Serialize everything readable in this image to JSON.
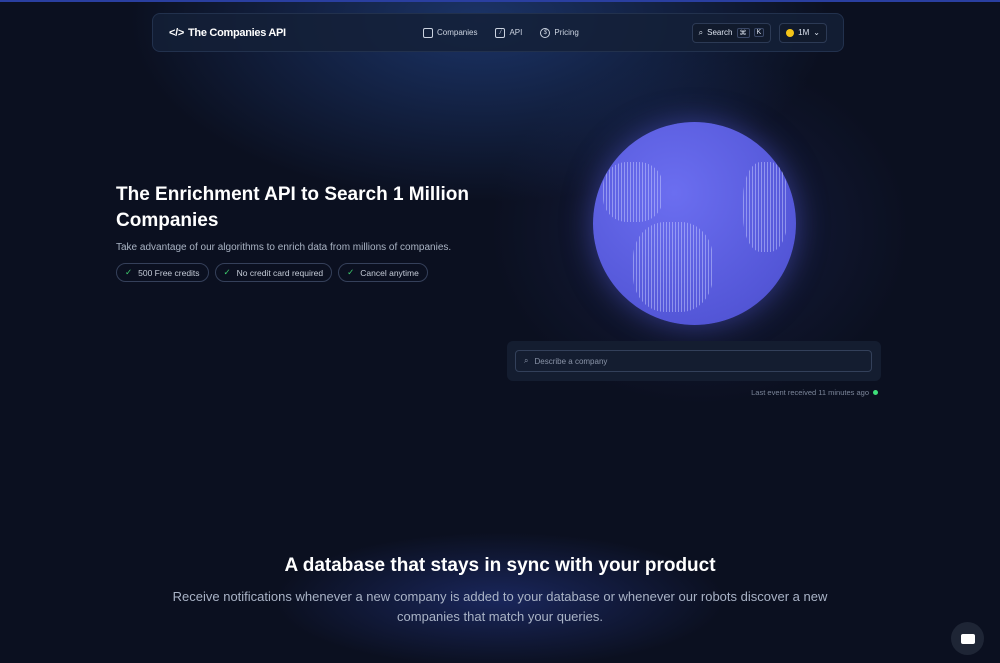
{
  "nav": {
    "logo": "The Companies API",
    "links": [
      "Companies",
      "API",
      "Pricing"
    ],
    "search_label": "Search",
    "shortcut": [
      "⌘",
      "K"
    ],
    "credits": "1M"
  },
  "hero": {
    "title": "The Enrichment API to Search 1 Million Companies",
    "subtitle": "Take advantage of our algorithms to enrich data from millions of companies.",
    "pills": [
      "500 Free credits",
      "No credit card required",
      "Cancel anytime"
    ]
  },
  "search": {
    "placeholder": "Describe a company",
    "event": "Last event received 11 minutes ago"
  },
  "section": {
    "title": "A database that stays in sync with your product",
    "text": "Receive notifications whenever a new company is added to your database or whenever our robots discover a new companies that match your queries."
  }
}
